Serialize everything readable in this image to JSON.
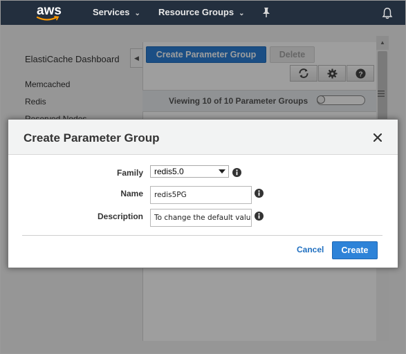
{
  "topnav": {
    "logo_text": "aws",
    "services_label": "Services",
    "resource_groups_label": "Resource Groups",
    "chevron_icon": "chevron-down-icon",
    "pin_icon": "pin-icon",
    "notifications_icon": "bell-icon",
    "background_color": "#232f3e"
  },
  "sidebar": {
    "title": "ElastiCache Dashboard",
    "items": [
      {
        "label": "Memcached"
      },
      {
        "label": "Redis"
      },
      {
        "label": "Reserved Nodes"
      }
    ]
  },
  "toolbar": {
    "create_label": "Create Parameter Group",
    "delete_label": "Delete",
    "icons": [
      "refresh-icon",
      "gear-icon",
      "help-icon"
    ]
  },
  "list": {
    "viewing_text": "Viewing 10 of 10 Parameter Groups"
  },
  "modal": {
    "title": "Create Parameter Group",
    "fields": {
      "family": {
        "label": "Family",
        "value": "redis5.0"
      },
      "name": {
        "label": "Name",
        "value": "redis5PG"
      },
      "description": {
        "label": "Description",
        "value": "To change the default value"
      }
    },
    "cancel_label": "Cancel",
    "create_label": "Create"
  },
  "colors": {
    "primary_button": "#2c7fd5",
    "link": "#1f6fc0"
  }
}
